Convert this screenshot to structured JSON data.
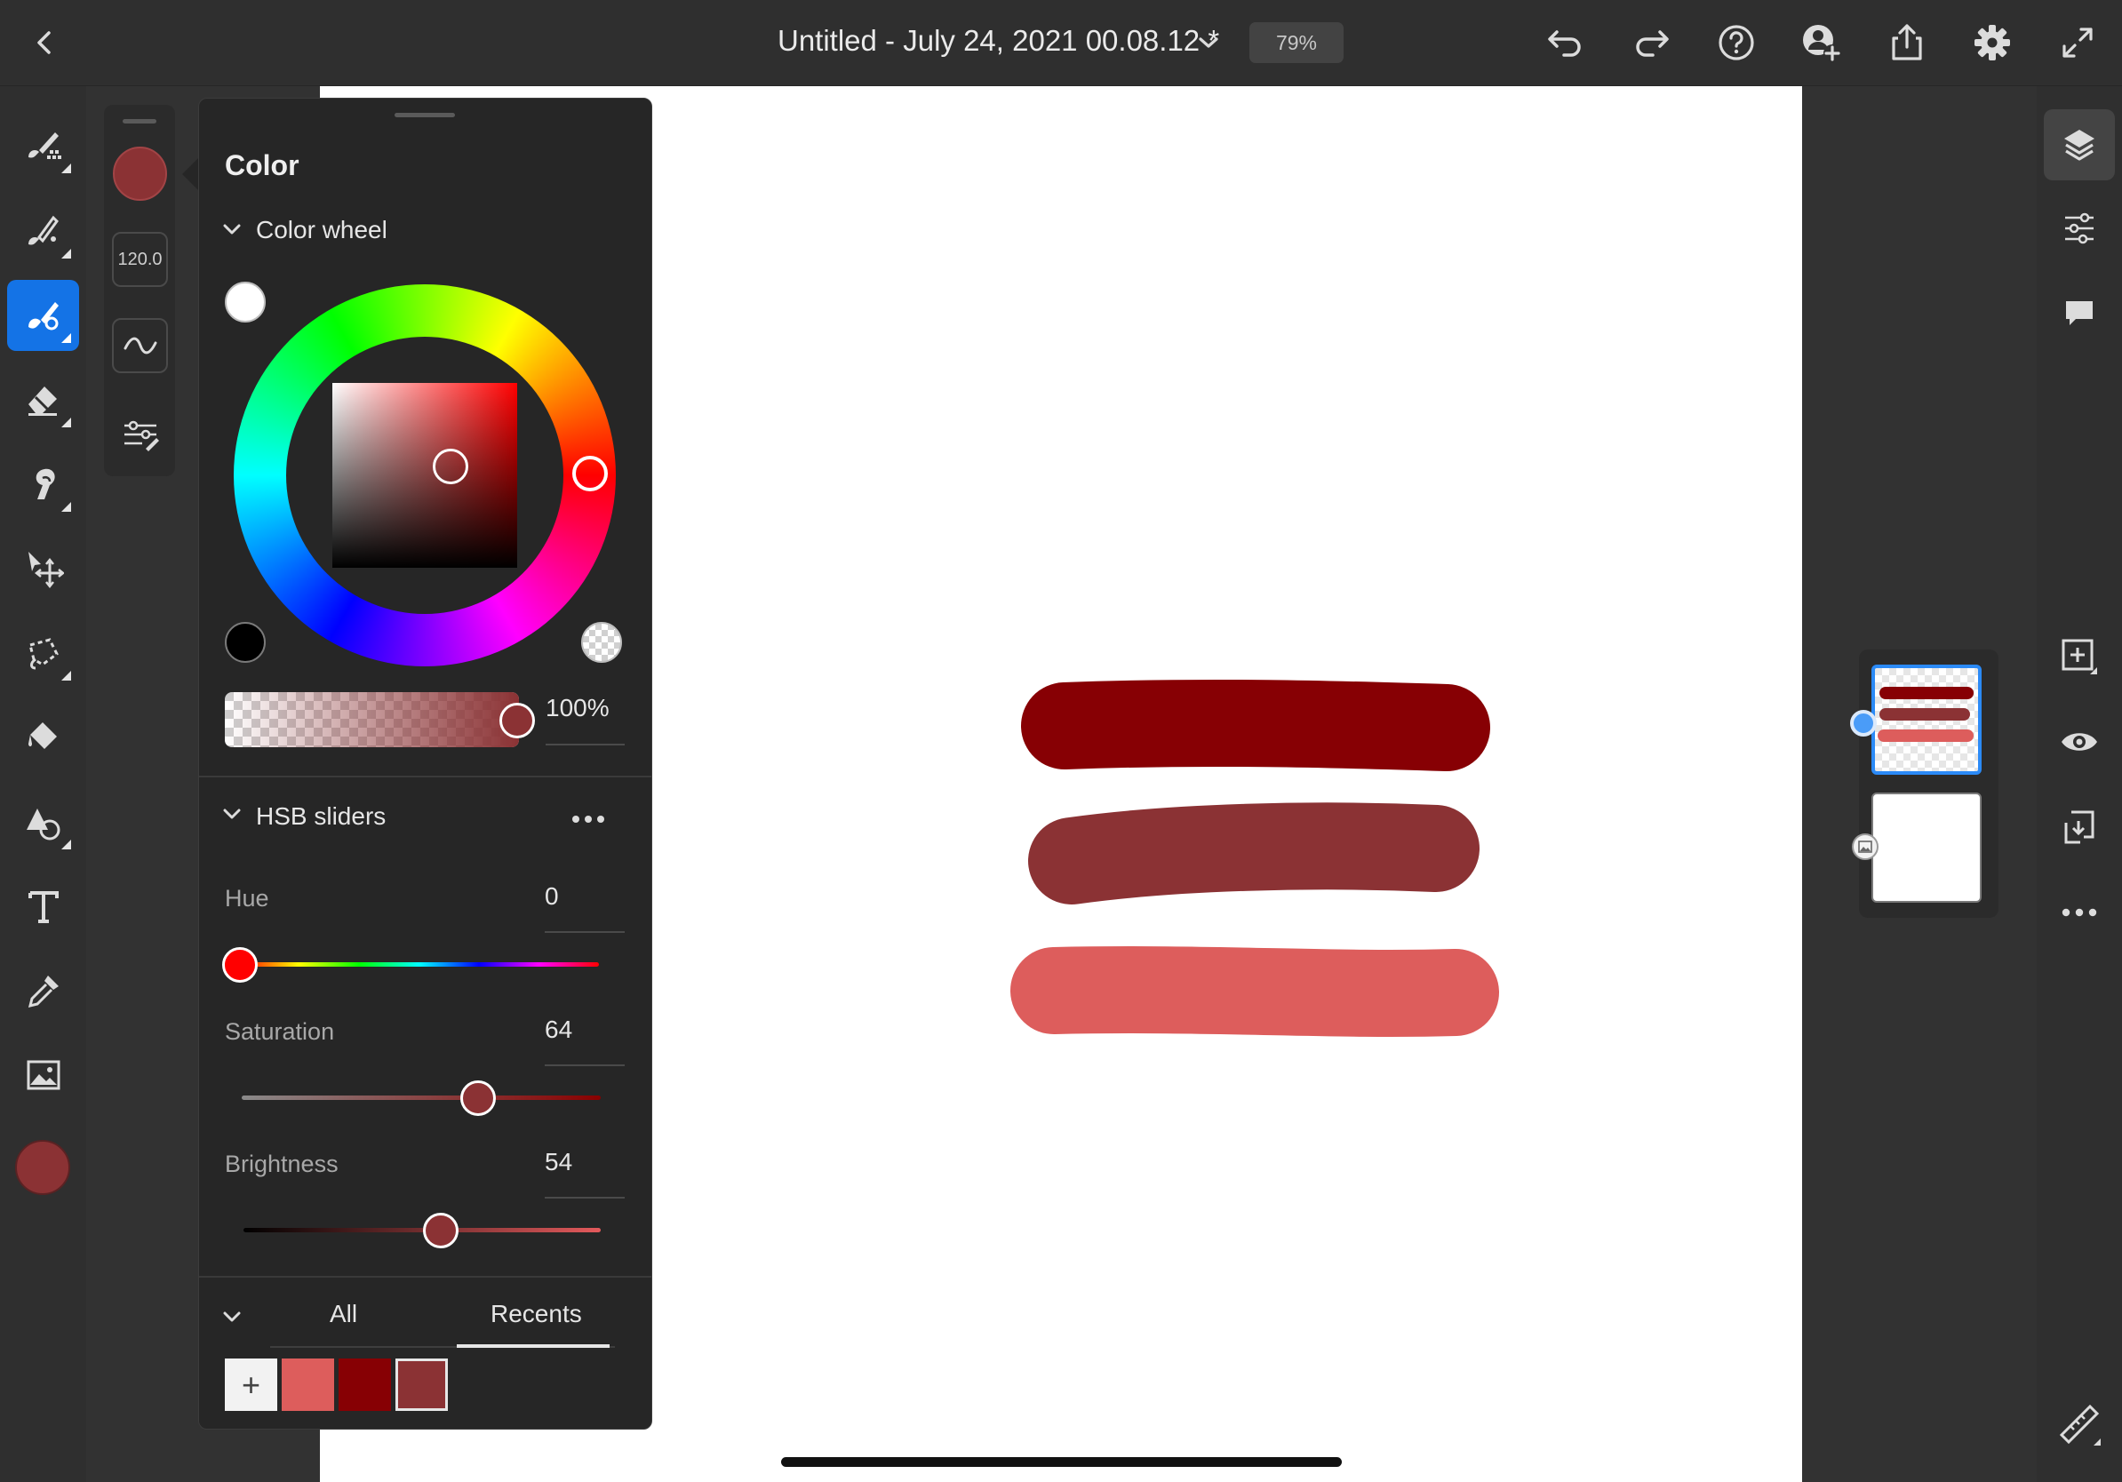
{
  "topbar": {
    "title": "Untitled - July 24, 2021 00.08.12 *",
    "zoom": "79%",
    "icons": [
      "back-icon",
      "chevron-down-icon",
      "undo-icon",
      "redo-icon",
      "help-icon",
      "invite-user-icon",
      "share-icon",
      "settings-icon",
      "fullscreen-icon"
    ]
  },
  "left_toolbar": {
    "tools": [
      "pixel-brush-icon",
      "live-brush-icon",
      "vector-brush-icon",
      "eraser-icon",
      "smudge-icon",
      "transform-icon",
      "lasso-selection-icon",
      "fill-icon",
      "shape-icon",
      "text-icon",
      "eyedropper-icon",
      "image-icon"
    ],
    "active_tool": "vector-brush-icon",
    "current_color": "#8b3234"
  },
  "brush_rail": {
    "size_value": "120.0",
    "color": "#8b3234"
  },
  "color_panel": {
    "title": "Color",
    "wheel_section_label": "Color wheel",
    "opacity_value": "100%",
    "hsb_section_label": "HSB sliders",
    "hue_label": "Hue",
    "hue_value": "0",
    "saturation_label": "Saturation",
    "saturation_value": "64",
    "brightness_label": "Brightness",
    "brightness_value": "54",
    "tab_all": "All",
    "tab_recents": "Recents",
    "active_tab": "Recents",
    "add_swatch_label": "+",
    "swatches": [
      "#dd5d5c",
      "#870004",
      "#8b3234"
    ],
    "selected_color": "#8b3234"
  },
  "canvas": {
    "stroke_colors": [
      "#870004",
      "#8b3234",
      "#dd5d5c"
    ]
  },
  "right_rail": {
    "icons": [
      "layers-icon",
      "adjustments-icon",
      "comments-icon",
      "add-layer-icon",
      "visibility-icon",
      "merge-layer-icon",
      "more-options-icon",
      "ruler-icon"
    ]
  }
}
